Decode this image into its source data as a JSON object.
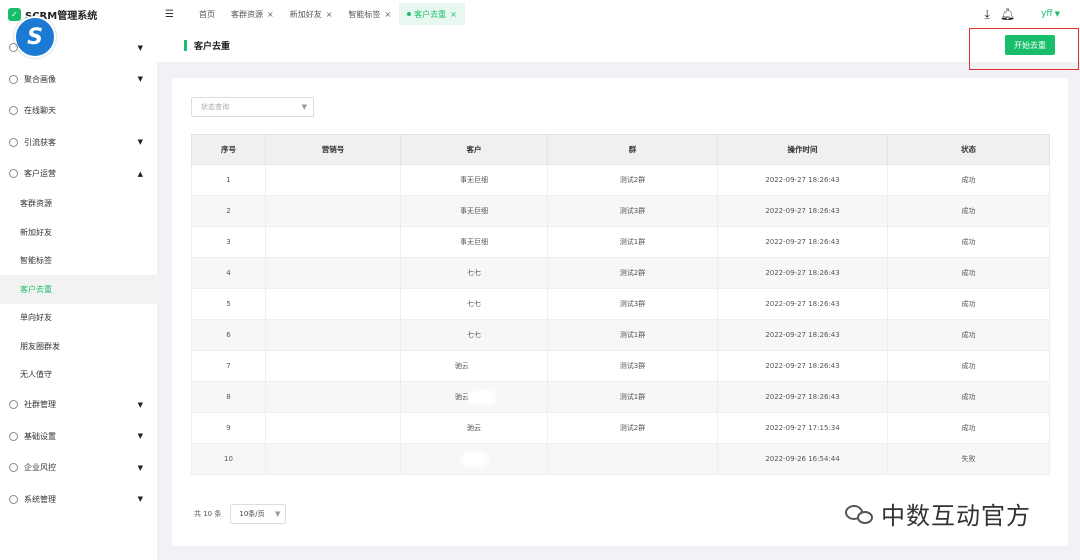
{
  "app": {
    "title": "SCRM管理系统",
    "brand_icon": "shield-check-icon",
    "logo_glyph": "S"
  },
  "sidebar": {
    "items": [
      {
        "label": "",
        "icon": "circle-icon",
        "expanded": false
      },
      {
        "label": "聚合画像",
        "icon": "user-circle-icon",
        "expanded": false
      },
      {
        "label": "在线聊天",
        "icon": "chat-icon",
        "expanded": null
      },
      {
        "label": "引流获客",
        "icon": "funnel-icon",
        "expanded": false
      },
      {
        "label": "客户运营",
        "icon": "user-icon",
        "expanded": true
      }
    ],
    "sub_items": [
      "客群资源",
      "新加好友",
      "智能标签",
      "客户去重",
      "单向好友",
      "朋友圈群发",
      "无人值守"
    ],
    "active_sub": "客户去重",
    "bottom_items": [
      {
        "label": "社群管理",
        "icon": "grid-icon"
      },
      {
        "label": "基础设置",
        "icon": "settings-icon"
      },
      {
        "label": "企业风控",
        "icon": "shield-icon"
      },
      {
        "label": "系统管理",
        "icon": "gear-icon"
      }
    ]
  },
  "topbar": {
    "menu_icon": "menu-fold-icon",
    "tabs": [
      {
        "label": "首页",
        "closable": false,
        "active": false
      },
      {
        "label": "客群资源",
        "closable": true,
        "active": false
      },
      {
        "label": "新加好友",
        "closable": true,
        "active": false
      },
      {
        "label": "智能标签",
        "closable": true,
        "active": false
      },
      {
        "label": "客户去重",
        "closable": true,
        "active": true
      }
    ],
    "close_glyph": "×",
    "user": "yff",
    "download_icon": "download-icon",
    "bell_icon": "bell-icon"
  },
  "page": {
    "title": "客户去重",
    "start_button": "开始去重",
    "filter_placeholder": "状态查询",
    "accent": "#19be6b"
  },
  "table": {
    "columns": [
      "序号",
      "营销号",
      "客户",
      "群",
      "操作时间",
      "状态"
    ],
    "rows": [
      {
        "no": "1",
        "account": "",
        "customer": "事无巨细",
        "group": "测试2群",
        "time": "2022-09-27 18:26:43",
        "status": "成功",
        "blurred": false
      },
      {
        "no": "2",
        "account": "",
        "customer": "事无巨细",
        "group": "测试3群",
        "time": "2022-09-27 18:26:43",
        "status": "成功",
        "blurred": false
      },
      {
        "no": "3",
        "account": "",
        "customer": "事无巨细",
        "group": "测试1群",
        "time": "2022-09-27 18:26:43",
        "status": "成功",
        "blurred": false
      },
      {
        "no": "4",
        "account": "",
        "customer": "七七",
        "group": "测试2群",
        "time": "2022-09-27 18:26:43",
        "status": "成功",
        "blurred": false
      },
      {
        "no": "5",
        "account": "",
        "customer": "七七",
        "group": "测试3群",
        "time": "2022-09-27 18:26:43",
        "status": "成功",
        "blurred": false
      },
      {
        "no": "6",
        "account": "",
        "customer": "七七",
        "group": "测试1群",
        "time": "2022-09-27 18:26:43",
        "status": "成功",
        "blurred": false
      },
      {
        "no": "7",
        "account": "",
        "customer": "驰云",
        "group": "测试3群",
        "time": "2022-09-27 18:26:43",
        "status": "成功",
        "blurred": true
      },
      {
        "no": "8",
        "account": "",
        "customer": "驰云",
        "group": "测试1群",
        "time": "2022-09-27 18:26:43",
        "status": "成功",
        "blurred": true
      },
      {
        "no": "9",
        "account": "",
        "customer": "驰云",
        "group": "测试2群",
        "time": "2022-09-27 17:15:34",
        "status": "成功",
        "blurred": false
      },
      {
        "no": "10",
        "account": "",
        "customer": "",
        "group": "",
        "time": "2022-09-26 16:54:44",
        "status": "失败",
        "blurred": true
      }
    ]
  },
  "pager": {
    "total": "共 10 条",
    "page_size": "10条/页"
  },
  "watermark": {
    "text": "中数互动官方",
    "icon": "wechat-icon"
  }
}
